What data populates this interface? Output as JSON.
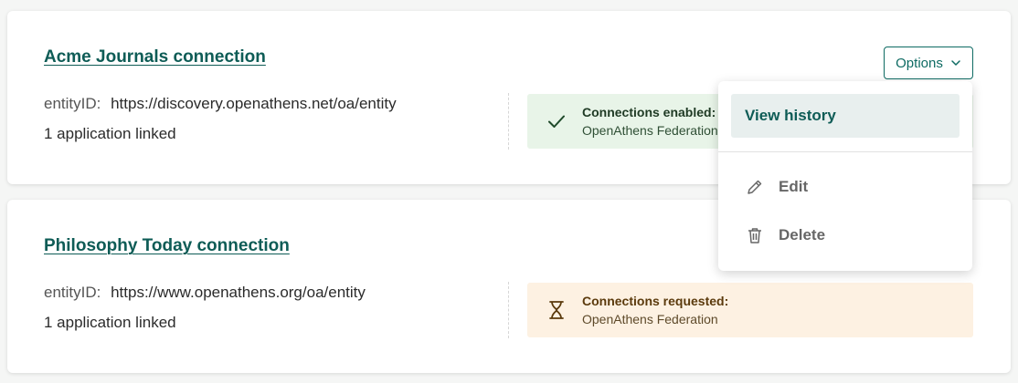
{
  "connections": [
    {
      "title": "Acme Journals connection",
      "entity_label": "entityID:",
      "entity_value": "https://discovery.openathens.net/oa/entity",
      "apps": "1 application linked",
      "status_title": "Connections enabled:",
      "status_sub": "OpenAthens Federation",
      "status_icon": "check-icon",
      "status_color": "#e8f4e8"
    },
    {
      "title": "Philosophy Today connection",
      "entity_label": "entityID:",
      "entity_value": "https://www.openathens.org/oa/entity",
      "apps": "1 application linked",
      "status_title": "Connections requested:",
      "status_sub": "OpenAthens Federation",
      "status_icon": "hourglass-icon",
      "status_color": "#fdf1e2"
    }
  ],
  "options_button": {
    "label": "Options",
    "icon": "chevron-down-icon"
  },
  "options_menu": {
    "items": [
      {
        "label": "View history",
        "icon": ""
      },
      {
        "label": "Edit",
        "icon": "pencil-icon"
      },
      {
        "label": "Delete",
        "icon": "trash-icon"
      }
    ]
  },
  "colors": {
    "accent": "#0e5c56",
    "background": "#f5f6f5"
  }
}
